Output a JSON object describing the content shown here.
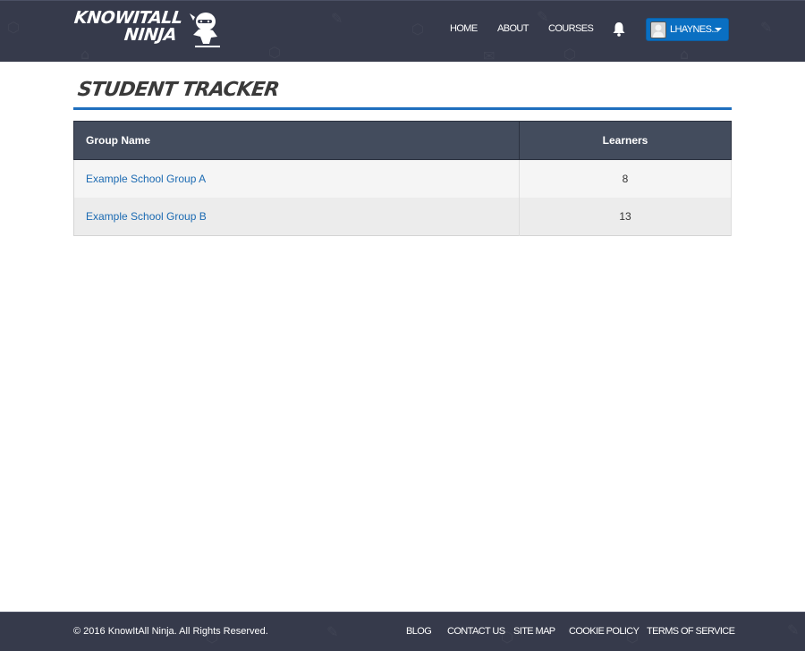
{
  "header": {
    "logo": {
      "line1": "KNOWITALL",
      "line2": "NINJA"
    },
    "nav": [
      {
        "label": "HOME"
      },
      {
        "label": "ABOUT"
      },
      {
        "label": "COURSES"
      }
    ],
    "notifications_icon": "bell-icon",
    "user": {
      "name": "LHAYNES...",
      "avatar_icon": "user-avatar-icon"
    }
  },
  "main": {
    "title": "STUDENT TRACKER",
    "table": {
      "columns": [
        "Group Name",
        "Learners"
      ],
      "rows": [
        {
          "group": "Example School Group A",
          "learners": "8"
        },
        {
          "group": "Example School Group B",
          "learners": "13"
        }
      ]
    }
  },
  "footer": {
    "copyright": "© 2016 KnowItAll Ninja. All Rights Reserved.",
    "links": [
      {
        "label": "BLOG"
      },
      {
        "label": "CONTACT US"
      },
      {
        "label": "SITE MAP"
      },
      {
        "label": "COOKIE POLICY"
      },
      {
        "label": "TERMS OF SERVICE"
      }
    ]
  },
  "colors": {
    "header_bg": "#363a4b",
    "accent_blue": "#0a6fc2",
    "table_header_bg": "#434c5d",
    "link": "#1b6ab2"
  }
}
